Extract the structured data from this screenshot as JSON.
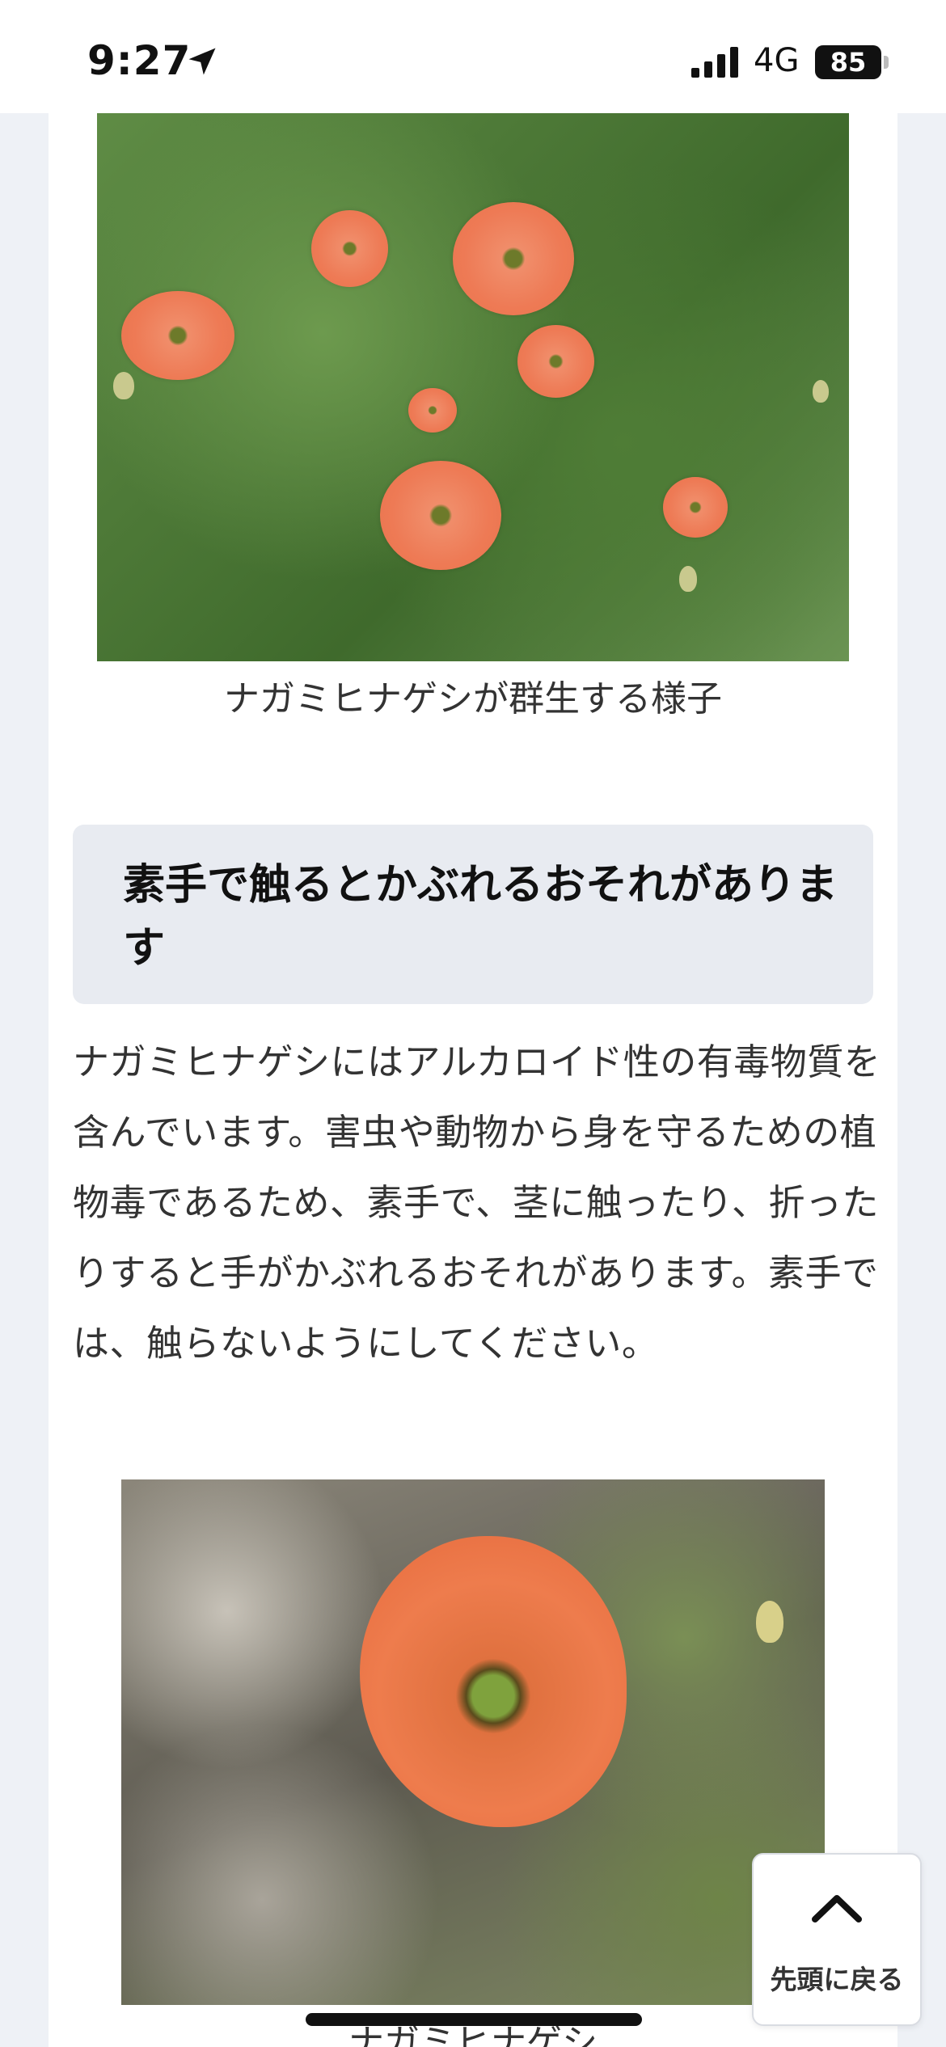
{
  "status_bar": {
    "time": "9:27",
    "network": "4G",
    "battery": "85"
  },
  "article": {
    "image1_caption": "ナガミヒナゲシが群生する様子",
    "section_heading": "素手で触るとかぶれるおそれがあります",
    "paragraph": "ナガミヒナゲシにはアルカロイド性の有毒物質を含んでいます。害虫や動物から身を守るための植物毒であるため、素手で、茎に触ったり、折ったりすると手がかぶれるおそれがあります。素手では、触らないようにしてください。",
    "image2_caption": "ナガミヒナゲシ"
  },
  "back_to_top": {
    "label": "先頭に戻る"
  },
  "colors": {
    "heading_bg": "#e8ebf1",
    "page_bg": "#eef1f6",
    "text": "#333333"
  },
  "icons": [
    "location-arrow-icon",
    "signal-icon",
    "battery-icon",
    "chevron-up-icon"
  ]
}
